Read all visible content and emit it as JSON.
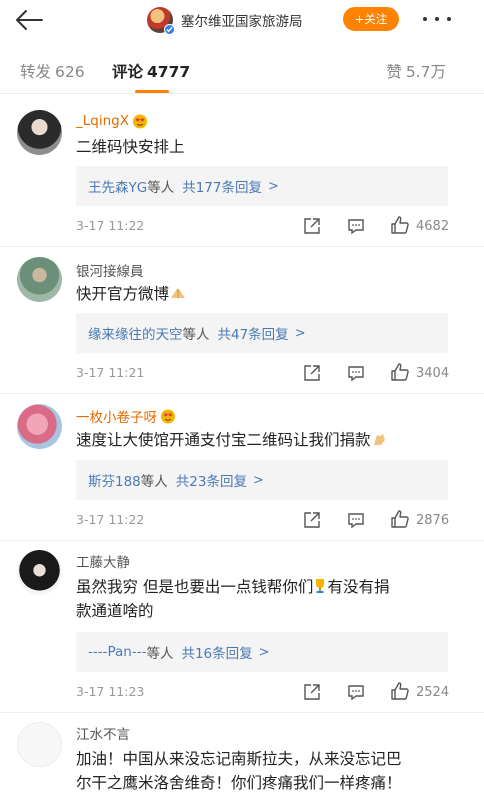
{
  "header": {
    "title": "塞尔维亚国家旅游局",
    "follow_label": "+关注"
  },
  "tabs": {
    "reposts_label": "转发",
    "reposts_count": "626",
    "comments_label": "评论",
    "comments_count": "4777",
    "likes_label": "赞",
    "likes_count": "5.7万"
  },
  "comments": [
    {
      "username": "_LqingX",
      "content": "二维码快安排上",
      "reply_names": "王先森YG",
      "reply_suffix": "等人",
      "reply_count": "共177条回复",
      "time": "3-17 11:22",
      "likes": "4682"
    },
    {
      "username": "银河接線員",
      "content": "快开官方微博",
      "reply_names": "缘来缘往的天空",
      "reply_suffix": "等人",
      "reply_count": "共47条回复",
      "time": "3-17 11:21",
      "likes": "3404"
    },
    {
      "username": "一枚小卷子呀",
      "content": "速度让大使馆开通支付宝二维码让我们捐款",
      "reply_names": "斯芬188",
      "reply_suffix": "等人",
      "reply_count": "共23条回复",
      "time": "3-17 11:22",
      "likes": "2876"
    },
    {
      "username": "工藤大静",
      "content_line1": "虽然我穷 但是也要出一点钱帮你们",
      "content_line1b": "有没有捐",
      "content_line2": "款通道啥的",
      "reply_names": "----Pan---",
      "reply_suffix": "等人",
      "reply_count": "共16条回复",
      "time": "3-17 11:23",
      "likes": "2524"
    },
    {
      "username": "江水不言",
      "content_line1": "加油！中国从来没忘记南斯拉夫，从来没忘记巴",
      "content_line2": "尔干之鹰米洛舍维奇！你们疼痛我们一样疼痛！"
    }
  ],
  "colors": {
    "accent": "#ff8200",
    "link": "#4a7ab5"
  }
}
